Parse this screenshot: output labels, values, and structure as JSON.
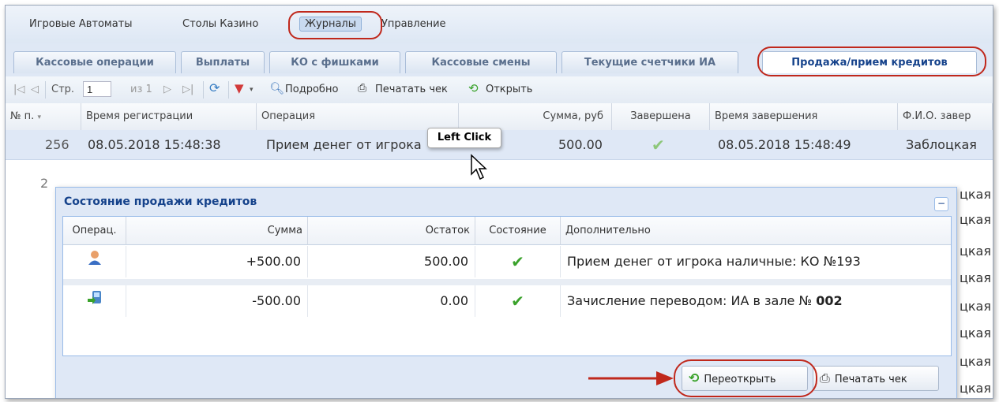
{
  "menu": {
    "items": [
      "Игровые Автоматы",
      "Столы Казино",
      "Журналы",
      "Управление"
    ]
  },
  "tabs": [
    "Кассовые операции",
    "Выплаты",
    "КО с фишками",
    "Кассовые смены",
    "Текущие счетчики ИА",
    "Продажа/прием кредитов"
  ],
  "toolbar": {
    "page_label": "Стр.",
    "page_value": "1",
    "page_total": "из 1",
    "details": "Подробно",
    "print": "Печатать чек",
    "open": "Открыть"
  },
  "grid": {
    "columns": [
      "№ п.",
      "Время регистрации",
      "Операция",
      "Сумма, руб",
      "Завершена",
      "Время завершения",
      "Ф.И.О. завер"
    ],
    "row": {
      "num": "256",
      "reg_time": "08.05.2018 15:48:38",
      "operation": "Прием денег от игрока",
      "sum": "500.00",
      "end_time": "08.05.2018 15:48:49",
      "fio": "Заблоцкая"
    },
    "behind_fio": "цкая",
    "behind_num": "2"
  },
  "tooltip": "Left Click",
  "panel": {
    "title": "Состояние продажи кредитов",
    "columns": [
      "Операц.",
      "Сумма",
      "Остаток",
      "Состояние",
      "Дополнительно"
    ],
    "rows": [
      {
        "icon": "user-icon",
        "sum": "+500.00",
        "rest": "500.00",
        "extra": "Прием денег от игрока наличные: КО №193",
        "extra_bold": ""
      },
      {
        "icon": "transfer-icon",
        "sum": "-500.00",
        "rest": "0.00",
        "extra": "Зачисление переводом: ИА в зале № ",
        "extra_bold": "002"
      }
    ],
    "reopen": "Переоткрыть",
    "print": "Печатать чек"
  },
  "colors": {
    "accent": "#15428b",
    "highlight": "#c0281c",
    "check": "#3aa22b"
  }
}
